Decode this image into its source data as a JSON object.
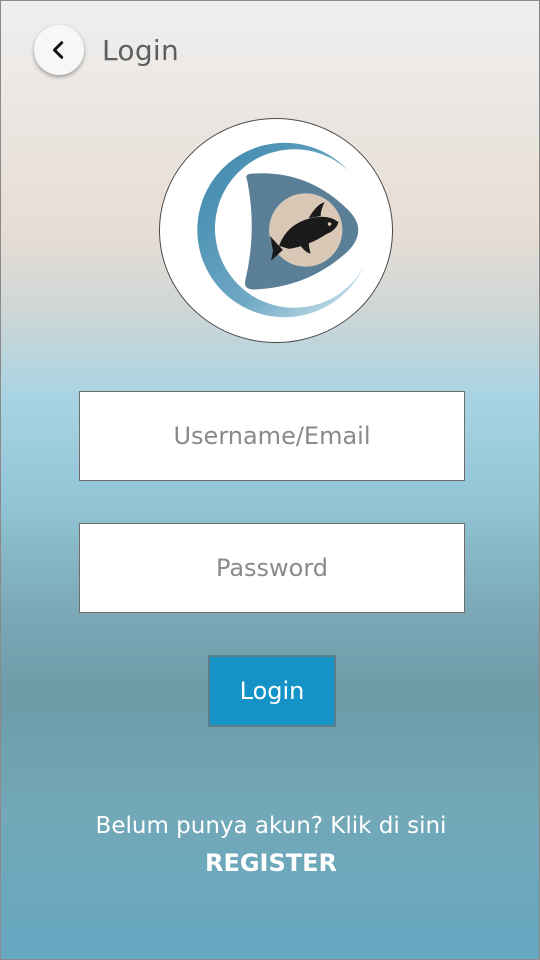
{
  "header": {
    "title": "Login",
    "back_icon": "chevron-left-icon"
  },
  "logo": {
    "icon": "fish-logo-icon",
    "colors": {
      "ring_start": "#3a86ab",
      "ring_end": "#cfe6ee",
      "shape": "#5b7f96",
      "inner_circle": "#d9c8b6",
      "fish": "#1a1a1a"
    }
  },
  "form": {
    "username_placeholder": "Username/Email",
    "password_placeholder": "Password",
    "login_label": "Login"
  },
  "footer": {
    "register_prompt": "Belum punya akun? Klik di sini",
    "register_label": "REGISTER"
  },
  "colors": {
    "accent": "#1593c6",
    "text_light": "#ffffff",
    "header_text": "#5f5f5f"
  }
}
